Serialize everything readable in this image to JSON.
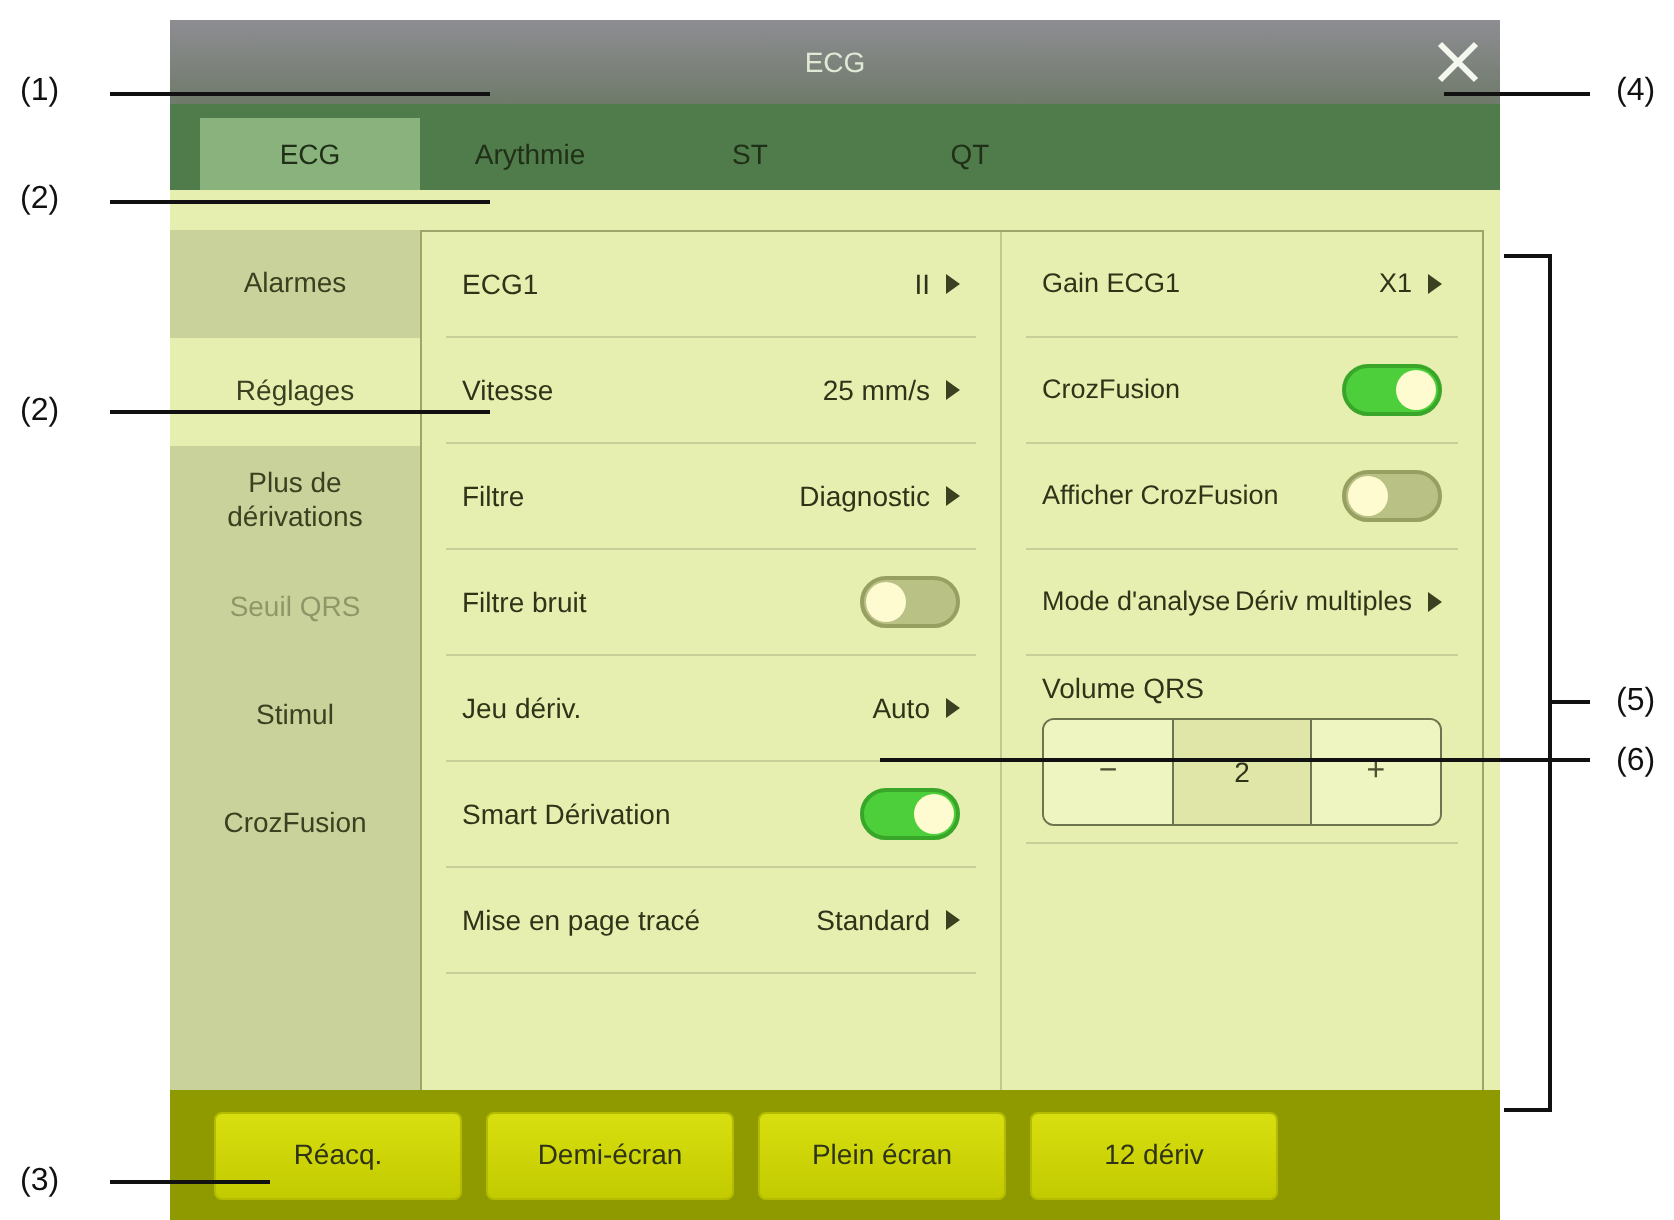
{
  "window": {
    "title": "ECG"
  },
  "tabs": [
    {
      "label": "ECG",
      "selected": true
    },
    {
      "label": "Arythmie",
      "selected": false
    },
    {
      "label": "ST",
      "selected": false
    },
    {
      "label": "QT",
      "selected": false
    }
  ],
  "side_menu": [
    {
      "label": "Alarmes",
      "selected": false,
      "disabled": false
    },
    {
      "label": "Réglages",
      "selected": true,
      "disabled": false
    },
    {
      "label": "Plus de dérivations",
      "selected": false,
      "disabled": false
    },
    {
      "label": "Seuil QRS",
      "selected": false,
      "disabled": true
    },
    {
      "label": "Stimul",
      "selected": false,
      "disabled": false
    },
    {
      "label": "CrozFusion",
      "selected": false,
      "disabled": false
    }
  ],
  "left_settings": [
    {
      "kind": "menu",
      "label": "ECG1",
      "value": "II"
    },
    {
      "kind": "menu",
      "label": "Vitesse",
      "value": "25 mm/s"
    },
    {
      "kind": "menu",
      "label": "Filtre",
      "value": "Diagnostic"
    },
    {
      "kind": "toggle",
      "label": "Filtre bruit",
      "on": false
    },
    {
      "kind": "menu",
      "label": "Jeu dériv.",
      "value": "Auto"
    },
    {
      "kind": "toggle",
      "label": "Smart Dérivation",
      "on": true
    },
    {
      "kind": "menu",
      "label": "Mise en page tracé",
      "value": "Standard"
    }
  ],
  "right_settings": [
    {
      "kind": "menu",
      "label": "Gain ECG1",
      "value": "X1"
    },
    {
      "kind": "toggle",
      "label": "CrozFusion",
      "on": true
    },
    {
      "kind": "toggle",
      "label": "Afficher CrozFusion",
      "on": false
    },
    {
      "kind": "menu",
      "label": "Mode d'analyse",
      "value": "Dériv multiples"
    },
    {
      "kind": "stepper",
      "label": "Volume QRS",
      "minus": "−",
      "value": "2",
      "plus": "+"
    }
  ],
  "buttons": [
    "Réacq.",
    "Demi-écran",
    "Plein écran",
    "12 dériv"
  ],
  "callouts": [
    "(1)",
    "(2)",
    "(2)",
    "(3)",
    "(4)",
    "(5)",
    "(6)"
  ]
}
